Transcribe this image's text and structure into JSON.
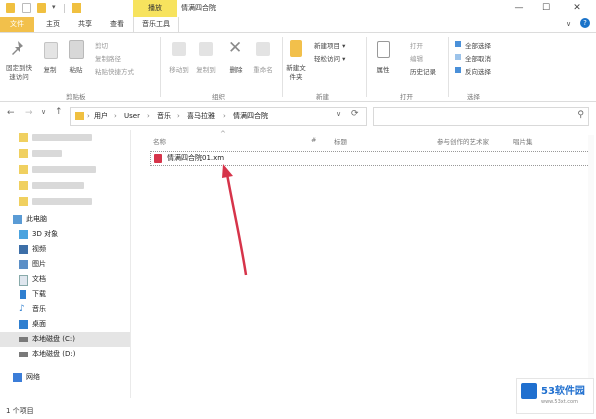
{
  "titlebar": {
    "context_tab": "播放",
    "title": "情满四合院",
    "controls": {
      "minimize": "—",
      "maximize": "☐",
      "close": "✕",
      "help": "?"
    }
  },
  "tabs": [
    "文件",
    "主页",
    "共享",
    "查看",
    "音乐工具"
  ],
  "ribbon": {
    "clipboard": {
      "pin_label": "固定到快速访问",
      "copy_label": "复制",
      "paste_label": "粘贴",
      "cut_label": "剪切",
      "copy_path_label": "复制路径",
      "paste_shortcut_label": "粘贴快捷方式",
      "group_label": "剪贴板"
    },
    "organize": {
      "move_to_label": "移动到",
      "copy_to_label": "复制到",
      "delete_label": "删除",
      "rename_label": "重命名",
      "group_label": "组织"
    },
    "new": {
      "new_folder_label": "新建文件夹",
      "new_item_label": "新建项目 ▾",
      "easy_access_label": "轻松访问 ▾",
      "group_label": "新建"
    },
    "open": {
      "properties_label": "属性",
      "open_label": "打开",
      "edit_label": "编辑",
      "history_label": "历史记录",
      "group_label": "打开"
    },
    "select": {
      "select_all_label": "全部选择",
      "select_none_label": "全部取消",
      "invert_label": "反向选择",
      "group_label": "选择"
    }
  },
  "address": {
    "back": "←",
    "forward": "→",
    "recent": "∨",
    "up": "↑",
    "breadcrumbs": [
      "用户",
      "User",
      "音乐",
      "喜马拉雅",
      "情满四合院"
    ],
    "separator": "›",
    "refresh": "⟳",
    "search_icon": "⚲"
  },
  "columns": [
    "名称",
    "#",
    "标题",
    "参与创作的艺术家",
    "唱片集"
  ],
  "files": [
    {
      "name": "情满四合院01.xm",
      "icon": "music-file-icon"
    }
  ],
  "sidebar": {
    "items": [
      {
        "label": "此电脑",
        "icon": "computer-icon"
      },
      {
        "label": "3D 对象",
        "icon": "3d-objects-icon"
      },
      {
        "label": "视频",
        "icon": "videos-icon"
      },
      {
        "label": "图片",
        "icon": "pictures-icon"
      },
      {
        "label": "文档",
        "icon": "documents-icon"
      },
      {
        "label": "下载",
        "icon": "downloads-icon"
      },
      {
        "label": "音乐",
        "icon": "music-icon"
      },
      {
        "label": "桌面",
        "icon": "desktop-icon"
      },
      {
        "label": "本地磁盘 (C:)",
        "icon": "drive-c-icon"
      },
      {
        "label": "本地磁盘 (D:)",
        "icon": "drive-d-icon"
      },
      {
        "label": "网络",
        "icon": "network-icon"
      }
    ]
  },
  "status": {
    "item_count": "1 个项目"
  },
  "watermark": {
    "brand": "53软件园",
    "url": "www.53xt.com"
  },
  "colors": {
    "accent": "#f2c04b",
    "selected": "#cce4f7",
    "context_tab": "#f7e35e",
    "arrow": "#d6344a"
  }
}
